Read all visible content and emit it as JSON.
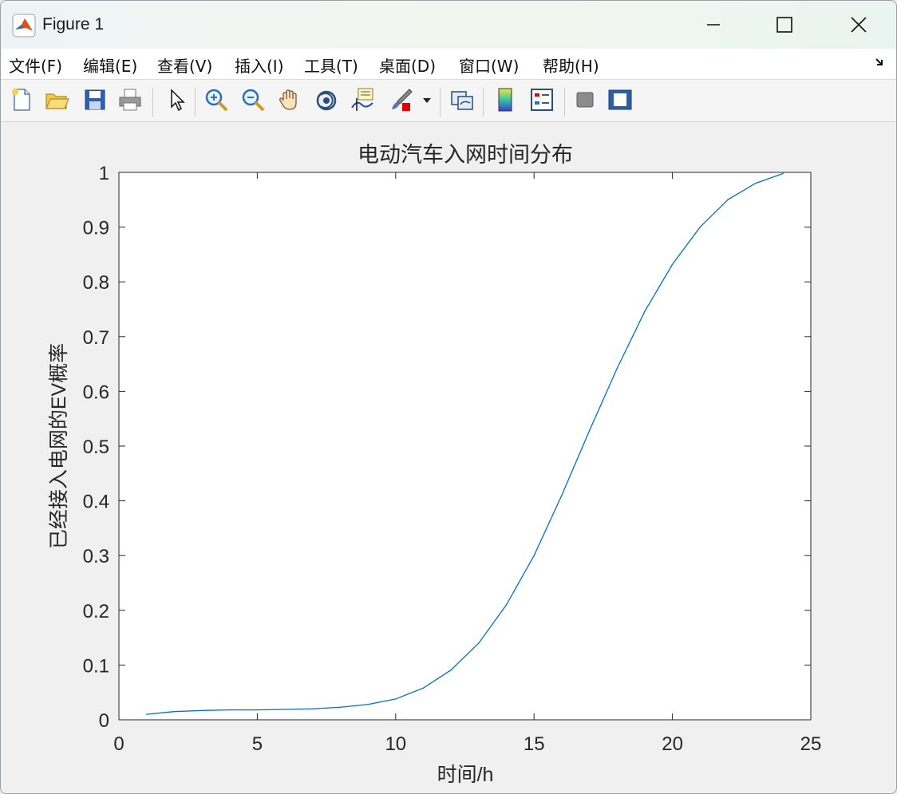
{
  "window": {
    "title": "Figure 1",
    "controls": {
      "minimize": "minimize",
      "maximize": "maximize",
      "close": "close"
    }
  },
  "menubar": {
    "items": [
      {
        "label": "文件(F)",
        "id": "file"
      },
      {
        "label": "编辑(E)",
        "id": "edit"
      },
      {
        "label": "查看(V)",
        "id": "view"
      },
      {
        "label": "插入(I)",
        "id": "insert"
      },
      {
        "label": "工具(T)",
        "id": "tools"
      },
      {
        "label": "桌面(D)",
        "id": "desktop"
      },
      {
        "label": "窗口(W)",
        "id": "window"
      },
      {
        "label": "帮助(H)",
        "id": "help"
      }
    ],
    "dock_icon": "dock-arrow-icon"
  },
  "toolbar": {
    "buttons": [
      "new-figure-icon",
      "open-folder-icon",
      "save-icon",
      "print-icon",
      "pointer-icon",
      "zoom-in-icon",
      "zoom-out-icon",
      "pan-hand-icon",
      "rotate-3d-icon",
      "data-cursor-icon",
      "brush-icon",
      "link-plot-icon",
      "colorbar-icon",
      "legend-icon",
      "hide-plot-tools-icon",
      "show-plot-tools-icon"
    ]
  },
  "chart_data": {
    "type": "line",
    "title": "电动汽车入网时间分布",
    "xlabel": "时间/h",
    "ylabel": "已经接入电网的EV概率",
    "xlim": [
      0,
      25
    ],
    "ylim": [
      0,
      1
    ],
    "xticks": [
      "0",
      "5",
      "10",
      "15",
      "20",
      "25"
    ],
    "yticks": [
      "0",
      "0.1",
      "0.2",
      "0.3",
      "0.4",
      "0.5",
      "0.6",
      "0.7",
      "0.8",
      "0.9",
      "1"
    ],
    "grid": false,
    "series": [
      {
        "color": "#0072BD",
        "x": [
          1,
          2,
          3,
          4,
          5,
          6,
          7,
          8,
          9,
          10,
          11,
          12,
          13,
          14,
          15,
          16,
          17,
          18,
          19,
          20,
          21,
          22,
          23,
          24
        ],
        "y": [
          0.01,
          0.015,
          0.017,
          0.018,
          0.018,
          0.019,
          0.02,
          0.023,
          0.028,
          0.038,
          0.058,
          0.091,
          0.14,
          0.21,
          0.3,
          0.41,
          0.528,
          0.642,
          0.746,
          0.832,
          0.9,
          0.95,
          0.98,
          0.998
        ]
      }
    ]
  }
}
